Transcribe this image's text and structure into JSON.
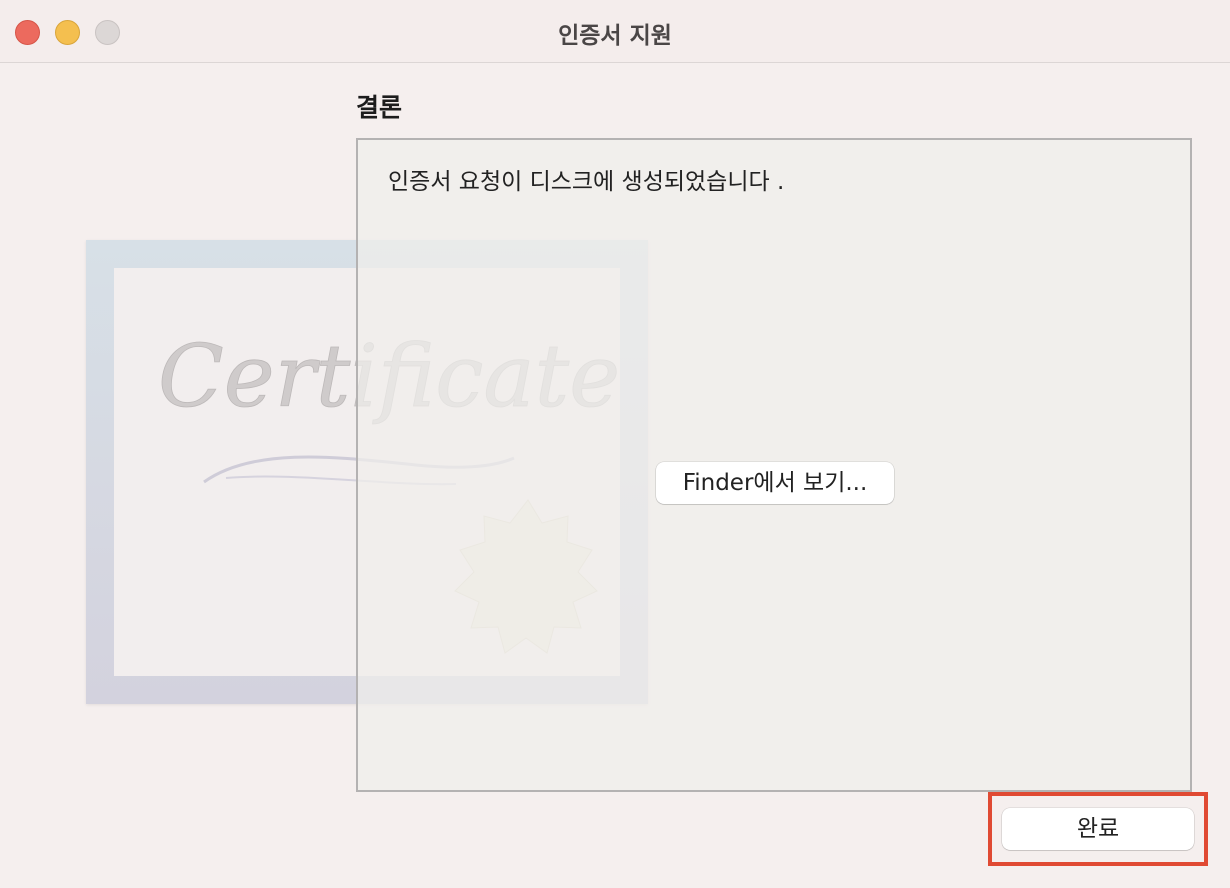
{
  "window": {
    "title": "인증서 지원"
  },
  "section": {
    "heading": "결론"
  },
  "result": {
    "message": "인증서 요청이 디스크에 생성되었습니다 ."
  },
  "buttons": {
    "finder_label": "Finder에서 보기...",
    "done_label": "완료"
  },
  "illustration": {
    "text": "Certificate"
  },
  "colors": {
    "close": "#ec6a5e",
    "minimize": "#f4bf4f",
    "zoom": "#dcd7d6",
    "highlight": "#e04a33"
  }
}
